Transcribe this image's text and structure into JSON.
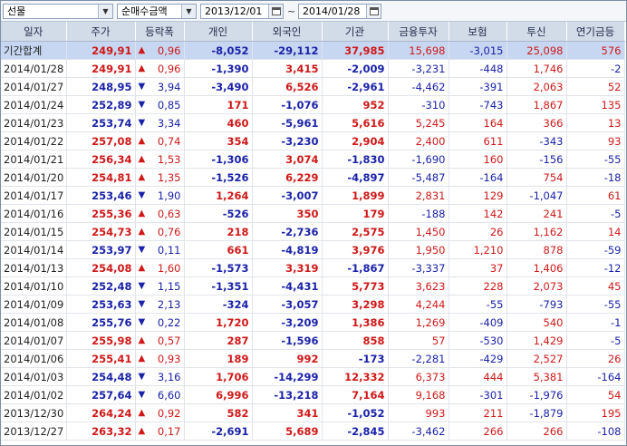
{
  "toolbar": {
    "market": "선물",
    "mode": "순매수금액",
    "date_from": "2013/12/01",
    "date_sep": "~",
    "date_to": "2014/01/28"
  },
  "headers": [
    "일자",
    "주가",
    "등락폭",
    "개인",
    "외국인",
    "기관",
    "금융투자",
    "보험",
    "투신",
    "연기금등"
  ],
  "total": {
    "date": "기간합계",
    "price": "249,91",
    "dir": "up",
    "change": "0,96",
    "indiv": "-8,052",
    "foreign": "-29,112",
    "inst": "37,985",
    "fin": "15,698",
    "ins": "-3,015",
    "trust": "25,098",
    "pension": "576"
  },
  "rows": [
    {
      "date": "2014/01/28",
      "price": "249,91",
      "dir": "up",
      "change": "0,96",
      "indiv": "-1,390",
      "foreign": "3,415",
      "inst": "-2,009",
      "fin": "-3,231",
      "ins": "-448",
      "trust": "1,746",
      "pension": "-2"
    },
    {
      "date": "2014/01/27",
      "price": "248,95",
      "dir": "dn",
      "change": "3,94",
      "indiv": "-3,490",
      "foreign": "6,526",
      "inst": "-2,961",
      "fin": "-4,462",
      "ins": "-391",
      "trust": "2,063",
      "pension": "52"
    },
    {
      "date": "2014/01/24",
      "price": "252,89",
      "dir": "dn",
      "change": "0,85",
      "indiv": "171",
      "foreign": "-1,076",
      "inst": "952",
      "fin": "-310",
      "ins": "-743",
      "trust": "1,867",
      "pension": "135"
    },
    {
      "date": "2014/01/23",
      "price": "253,74",
      "dir": "dn",
      "change": "3,34",
      "indiv": "460",
      "foreign": "-5,961",
      "inst": "5,616",
      "fin": "5,245",
      "ins": "164",
      "trust": "366",
      "pension": "13"
    },
    {
      "date": "2014/01/22",
      "price": "257,08",
      "dir": "up",
      "change": "0,74",
      "indiv": "354",
      "foreign": "-3,230",
      "inst": "2,904",
      "fin": "2,400",
      "ins": "611",
      "trust": "-343",
      "pension": "93"
    },
    {
      "date": "2014/01/21",
      "price": "256,34",
      "dir": "up",
      "change": "1,53",
      "indiv": "-1,306",
      "foreign": "3,074",
      "inst": "-1,830",
      "fin": "-1,690",
      "ins": "160",
      "trust": "-156",
      "pension": "-55"
    },
    {
      "date": "2014/01/20",
      "price": "254,81",
      "dir": "up",
      "change": "1,35",
      "indiv": "-1,526",
      "foreign": "6,229",
      "inst": "-4,897",
      "fin": "-5,487",
      "ins": "-164",
      "trust": "754",
      "pension": "-18"
    },
    {
      "date": "2014/01/17",
      "price": "253,46",
      "dir": "dn",
      "change": "1,90",
      "indiv": "1,264",
      "foreign": "-3,007",
      "inst": "1,899",
      "fin": "2,831",
      "ins": "129",
      "trust": "-1,047",
      "pension": "61"
    },
    {
      "date": "2014/01/16",
      "price": "255,36",
      "dir": "up",
      "change": "0,63",
      "indiv": "-526",
      "foreign": "350",
      "inst": "179",
      "fin": "-188",
      "ins": "142",
      "trust": "241",
      "pension": "-5"
    },
    {
      "date": "2014/01/15",
      "price": "254,73",
      "dir": "up",
      "change": "0,76",
      "indiv": "218",
      "foreign": "-2,736",
      "inst": "2,575",
      "fin": "1,450",
      "ins": "26",
      "trust": "1,162",
      "pension": "14"
    },
    {
      "date": "2014/01/14",
      "price": "253,97",
      "dir": "dn",
      "change": "0,11",
      "indiv": "661",
      "foreign": "-4,819",
      "inst": "3,976",
      "fin": "1,950",
      "ins": "1,210",
      "trust": "878",
      "pension": "-59"
    },
    {
      "date": "2014/01/13",
      "price": "254,08",
      "dir": "up",
      "change": "1,60",
      "indiv": "-1,573",
      "foreign": "3,319",
      "inst": "-1,867",
      "fin": "-3,337",
      "ins": "37",
      "trust": "1,406",
      "pension": "-12"
    },
    {
      "date": "2014/01/10",
      "price": "252,48",
      "dir": "dn",
      "change": "1,15",
      "indiv": "-1,351",
      "foreign": "-4,431",
      "inst": "5,773",
      "fin": "3,623",
      "ins": "228",
      "trust": "2,073",
      "pension": "45"
    },
    {
      "date": "2014/01/09",
      "price": "253,63",
      "dir": "dn",
      "change": "2,13",
      "indiv": "-324",
      "foreign": "-3,057",
      "inst": "3,298",
      "fin": "4,244",
      "ins": "-55",
      "trust": "-793",
      "pension": "-55"
    },
    {
      "date": "2014/01/08",
      "price": "255,76",
      "dir": "dn",
      "change": "0,22",
      "indiv": "1,720",
      "foreign": "-3,209",
      "inst": "1,386",
      "fin": "1,269",
      "ins": "-409",
      "trust": "540",
      "pension": "-1"
    },
    {
      "date": "2014/01/07",
      "price": "255,98",
      "dir": "up",
      "change": "0,57",
      "indiv": "287",
      "foreign": "-1,596",
      "inst": "858",
      "fin": "57",
      "ins": "-530",
      "trust": "1,429",
      "pension": "-5"
    },
    {
      "date": "2014/01/06",
      "price": "255,41",
      "dir": "up",
      "change": "0,93",
      "indiv": "189",
      "foreign": "992",
      "inst": "-173",
      "fin": "-2,281",
      "ins": "-429",
      "trust": "2,527",
      "pension": "26"
    },
    {
      "date": "2014/01/03",
      "price": "254,48",
      "dir": "dn",
      "change": "3,16",
      "indiv": "1,706",
      "foreign": "-14,299",
      "inst": "12,332",
      "fin": "6,373",
      "ins": "444",
      "trust": "5,381",
      "pension": "-164"
    },
    {
      "date": "2014/01/02",
      "price": "257,64",
      "dir": "dn",
      "change": "6,60",
      "indiv": "6,996",
      "foreign": "-13,218",
      "inst": "7,164",
      "fin": "9,168",
      "ins": "-301",
      "trust": "-1,976",
      "pension": "54"
    },
    {
      "date": "2013/12/30",
      "price": "264,24",
      "dir": "up",
      "change": "0,92",
      "indiv": "582",
      "foreign": "341",
      "inst": "-1,052",
      "fin": "993",
      "ins": "211",
      "trust": "-1,879",
      "pension": "195"
    },
    {
      "date": "2013/12/27",
      "price": "263,32",
      "dir": "up",
      "change": "0,17",
      "indiv": "-2,691",
      "foreign": "5,689",
      "inst": "-2,845",
      "fin": "-3,462",
      "ins": "266",
      "trust": "266",
      "pension": "-108"
    }
  ],
  "colors": {
    "up": "#d01818",
    "down": "#1a22a8",
    "header_bg": "#d2dbe8",
    "total_bg": "#c7d7f1"
  },
  "icons": {
    "up": "up-triangle-icon",
    "down": "down-triangle-icon",
    "calendar": "calendar-icon",
    "dropdown": "chevron-down-icon"
  }
}
